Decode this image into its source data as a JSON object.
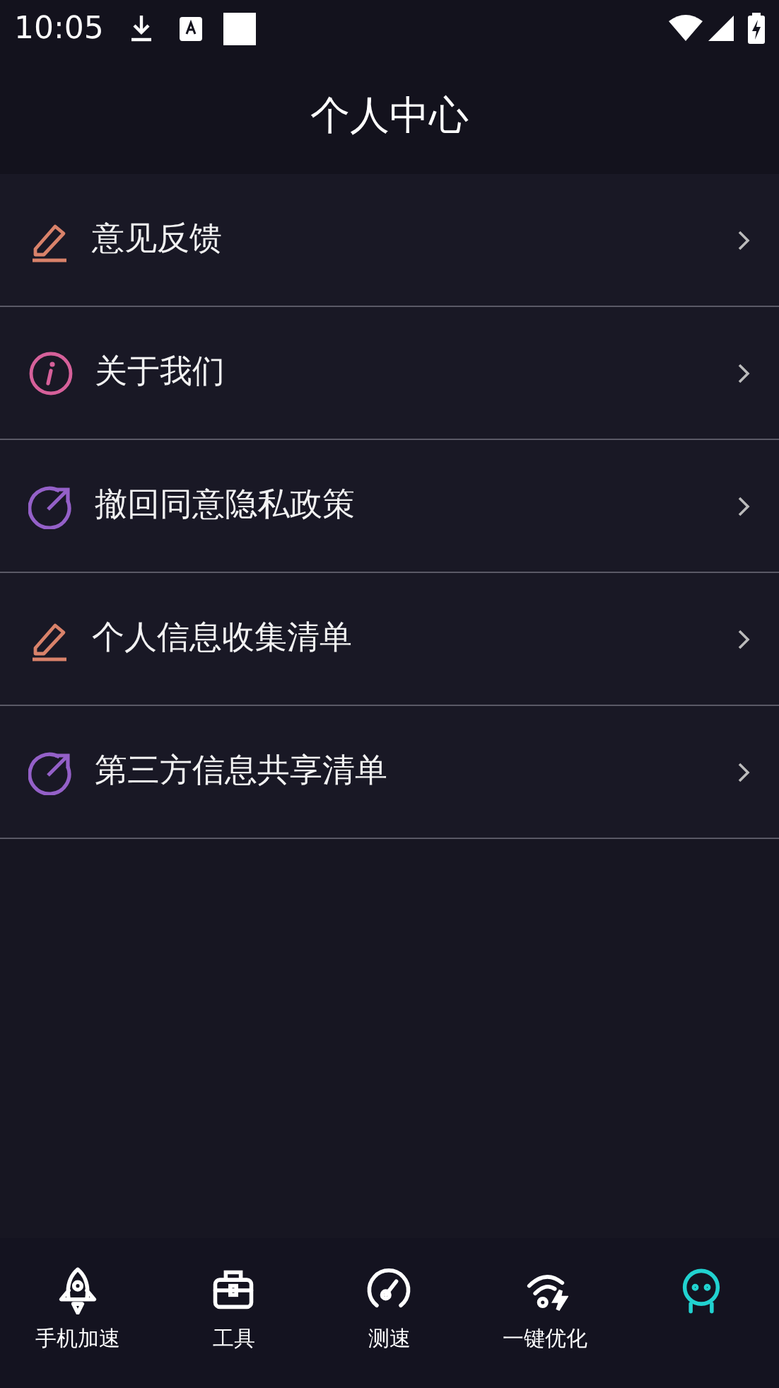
{
  "status_bar": {
    "time": "10:05"
  },
  "header": {
    "title": "个人中心"
  },
  "menu": [
    {
      "label": "意见反馈",
      "kind": "edit"
    },
    {
      "label": "关于我们",
      "kind": "info"
    },
    {
      "label": "撤回同意隐私政策",
      "kind": "share"
    },
    {
      "label": "个人信息收集清单",
      "kind": "edit"
    },
    {
      "label": "第三方信息共享清单",
      "kind": "share"
    }
  ],
  "tabs": [
    {
      "label": "手机加速",
      "kind": "rocket",
      "selected": false
    },
    {
      "label": "工具",
      "kind": "toolbox",
      "selected": false
    },
    {
      "label": "测速",
      "kind": "gauge",
      "selected": false
    },
    {
      "label": "一键优化",
      "kind": "wifi",
      "selected": false
    },
    {
      "kind": "robot",
      "selected": true
    }
  ]
}
